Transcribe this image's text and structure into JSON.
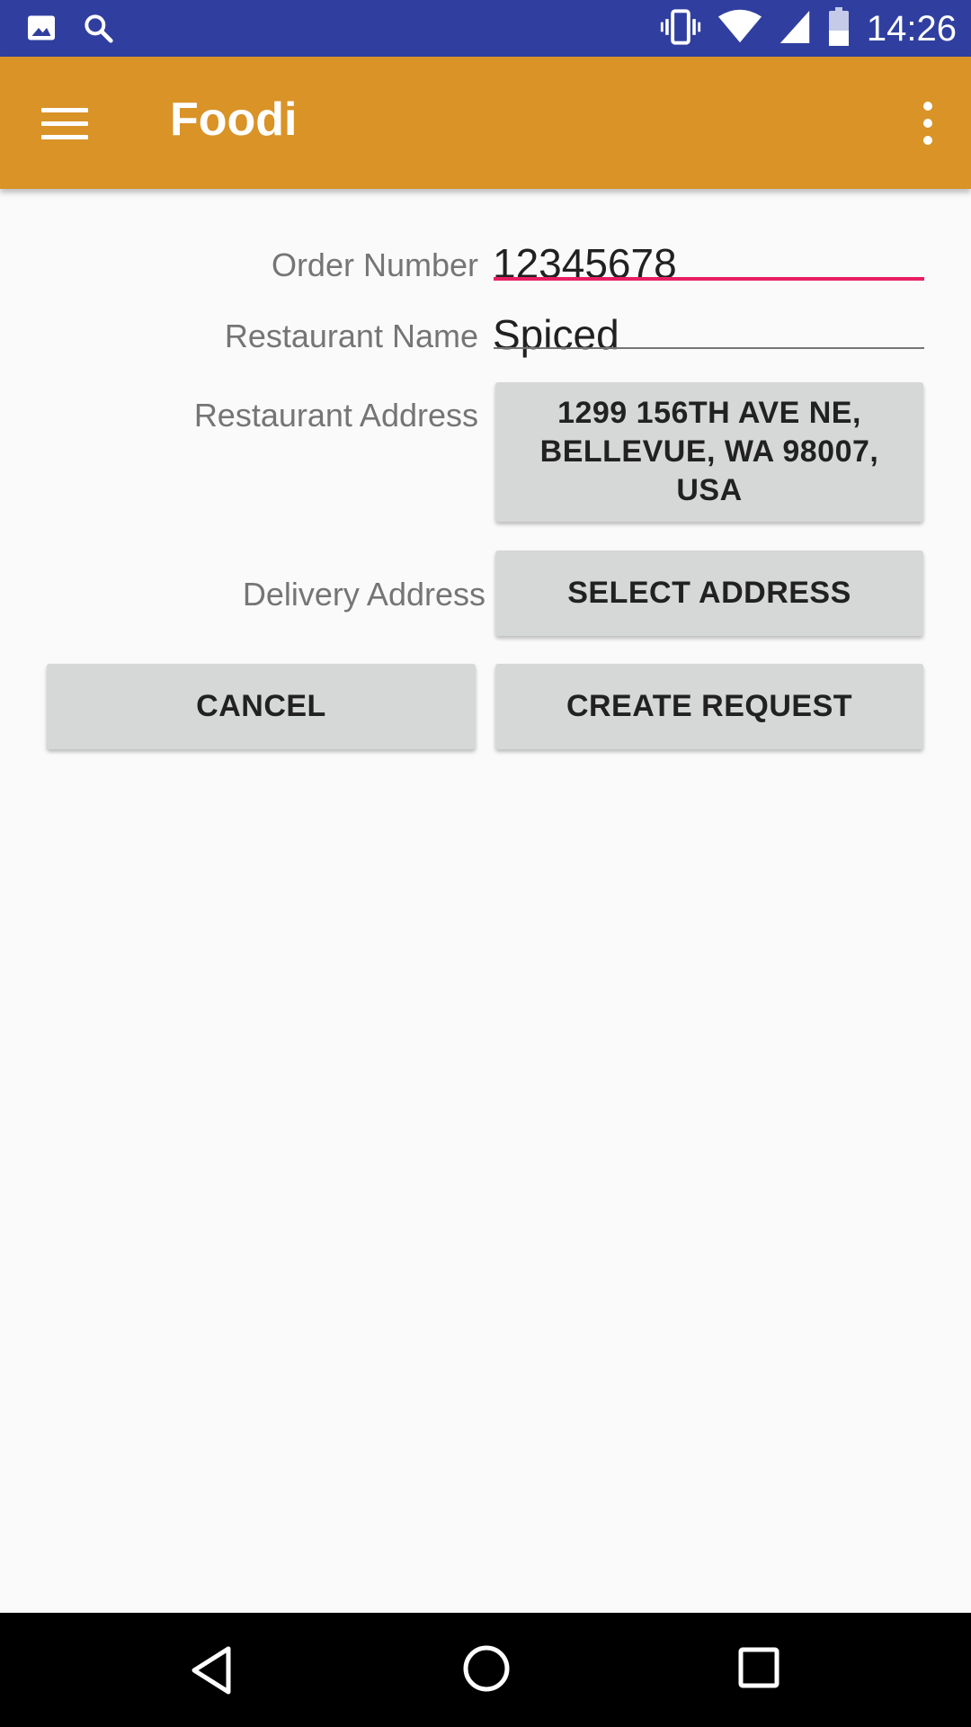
{
  "status_bar": {
    "time": "14:26",
    "icons_left": [
      "image-icon",
      "search-icon"
    ],
    "icons_right": [
      "vibrate-icon",
      "wifi-icon",
      "signal-icon",
      "battery-icon"
    ]
  },
  "app_bar": {
    "title": "Foodi",
    "icons": [
      "menu-icon",
      "more-vert-icon"
    ],
    "color": "#d99327"
  },
  "form": {
    "order_number": {
      "label": "Order Number",
      "value": "12345678"
    },
    "restaurant_name": {
      "label": "Restaurant Name",
      "value": "Spiced"
    },
    "restaurant_address": {
      "label": "Restaurant Address",
      "button_label": "1299 156TH AVE NE, BELLEVUE, WA 98007, USA"
    },
    "delivery_address": {
      "label": "Delivery Address",
      "button_label": "SELECT ADDRESS"
    }
  },
  "actions": {
    "cancel_label": "CANCEL",
    "create_label": "CREATE REQUEST"
  },
  "nav_bar": {
    "icons": [
      "back-icon",
      "home-icon",
      "recents-icon"
    ]
  },
  "colors": {
    "status_bar": "#303f9f",
    "accent_underline": "#e91e63",
    "button_bg": "#d6d7d7"
  }
}
